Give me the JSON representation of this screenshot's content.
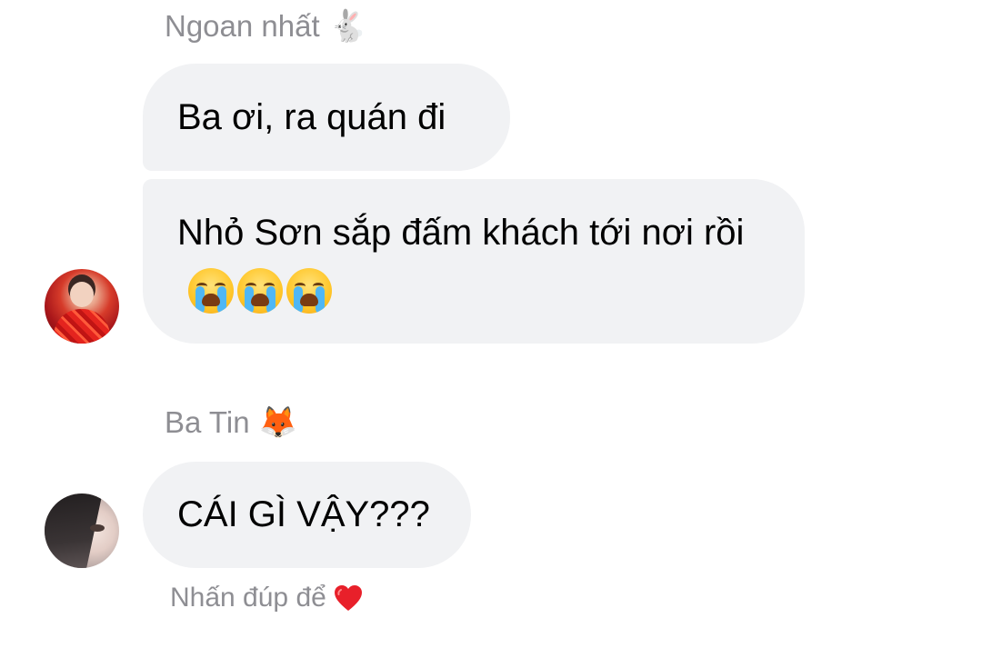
{
  "thread": {
    "groups": [
      {
        "sender_name": "Ngoan nhất",
        "sender_emoji": "🐇",
        "sender_emoji_icon": "rabbit-icon",
        "messages": [
          {
            "text": "Ba ơi, ra quán đi"
          },
          {
            "text": "Nhỏ Sơn sắp đấm khách tới nơi rồi",
            "emoji_icon": "loudly-crying-face-icon",
            "emoji_count": 3
          }
        ]
      },
      {
        "sender_name": "Ba Tin",
        "sender_emoji": "🦊",
        "sender_emoji_icon": "fox-icon",
        "messages": [
          {
            "text": "CÁI GÌ VẬY???"
          }
        ],
        "reaction_hint": "Nhấn đúp để",
        "reaction_icon": "heart-icon",
        "reaction_color": "#e8202a"
      }
    ]
  },
  "colors": {
    "bubble_bg": "#f1f2f4",
    "secondary_text": "#8e8e93",
    "message_text": "#000000"
  }
}
